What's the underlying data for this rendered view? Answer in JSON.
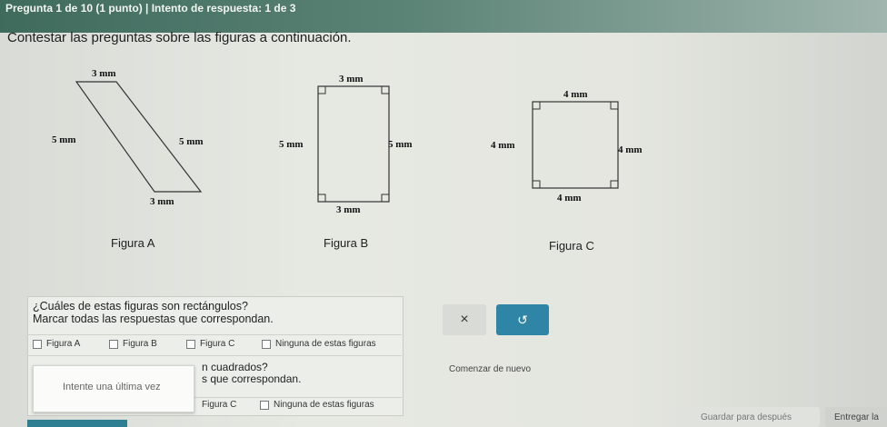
{
  "header": {
    "question_info": "Pregunta 1 de 10 (1 punto)  |  Intento de respuesta: 1 de 3"
  },
  "instructions": "Contestar las preguntas sobre las figuras a continuación.",
  "figures": {
    "a": {
      "label": "Figura A",
      "top": "3 mm",
      "left": "5 mm",
      "right": "5 mm",
      "bottom": "3 mm"
    },
    "b": {
      "label": "Figura B",
      "top": "3 mm",
      "left": "5 mm",
      "right": "5 mm",
      "bottom": "3 mm"
    },
    "c": {
      "label": "Figura C",
      "top": "4 mm",
      "left": "4 mm",
      "right": "4 mm",
      "bottom": "4 mm"
    }
  },
  "question1": {
    "line1": "¿Cuáles de estas figuras son rectángulos?",
    "line2": "Marcar todas las respuestas que correspondan.",
    "options": [
      "Figura A",
      "Figura B",
      "Figura C",
      "Ninguna de estas figuras"
    ]
  },
  "question2": {
    "line1": "n cuadrados?",
    "line2": "s que correspondan.",
    "options": [
      "Figura C",
      "Ninguna de estas figuras"
    ]
  },
  "popup": {
    "text": "Intente una última vez"
  },
  "buttons": {
    "clear": "×",
    "undo": "↺",
    "restart": "Comenzar de nuevo",
    "save": "Guardar para después",
    "submit": "Entregar la"
  }
}
